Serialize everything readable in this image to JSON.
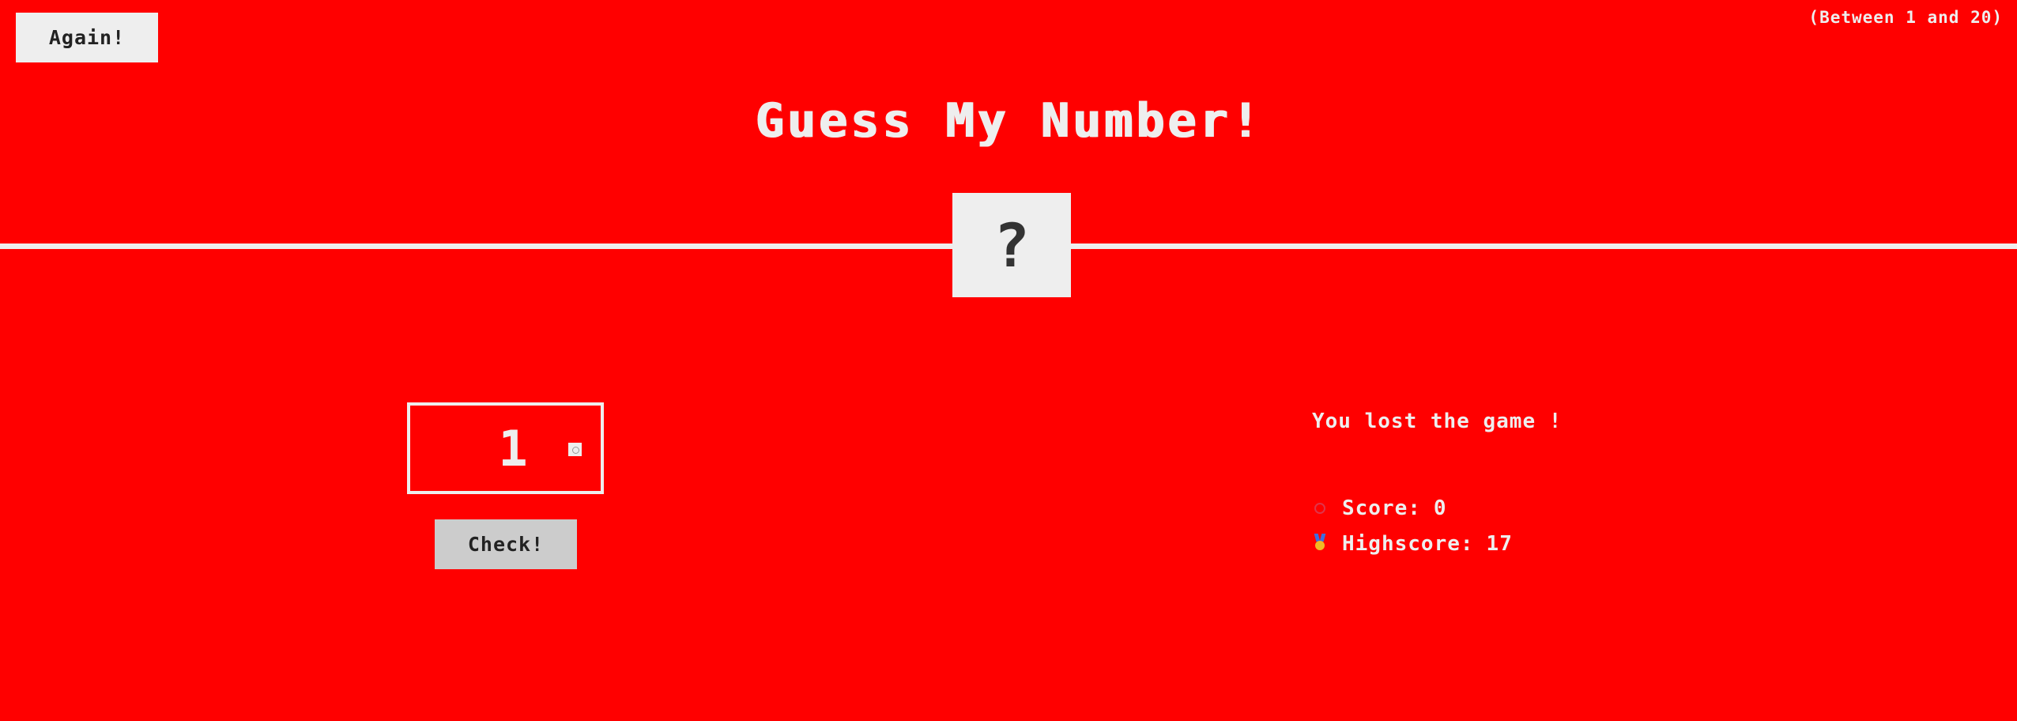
{
  "header": {
    "again_label": "Again!",
    "range_hint": "(Between 1 and 20)",
    "title": "Guess My Number!"
  },
  "secret": {
    "display": "?"
  },
  "guess": {
    "value": "1",
    "check_label": "Check!"
  },
  "status": {
    "message": "You lost the game !",
    "score_label": "Score:",
    "score_value": "0",
    "score_icon": "target-icon",
    "highscore_label": "Highscore:",
    "highscore_value": "17",
    "highscore_icon": "medal-icon"
  },
  "colors": {
    "background": "#ff0000",
    "foreground": "#eeeeee",
    "dark_text": "#333333"
  }
}
